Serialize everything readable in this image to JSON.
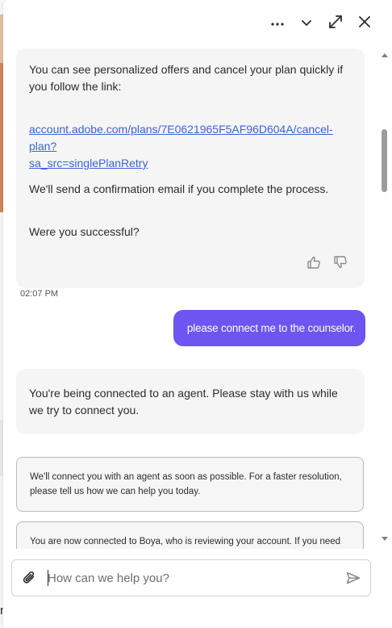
{
  "header": {
    "more_icon": "ellipsis-icon",
    "minimize_icon": "chevron-down-icon",
    "expand_icon": "expand-icon",
    "close_icon": "close-icon"
  },
  "messages": {
    "bot_1": {
      "line_1": "You can see personalized offers and cancel your plan quickly if you follow the link:",
      "link_line_1": "account.adobe.com/plans/7E0621965F5AF96D604A/cancel-plan?",
      "link_line_2": "sa_src=singlePlanRetry",
      "line_2": "We'll send a confirmation email if you complete the process.",
      "line_3": "Were you successful?"
    },
    "timestamp": "02:07 PM",
    "user_1": "please connect me to the counselor.",
    "bot_2": "You're being connected to an agent. Please stay with us while we try to connect you.",
    "card_1": "We'll connect you with an agent as soon as possible. For a faster resolution, please tell us how we can help you today.",
    "card_2": "You are now connected to Boya, who is reviewing your account. If you need"
  },
  "composer": {
    "placeholder": "How can we help you?",
    "attach_icon": "paperclip-icon",
    "send_icon": "send-icon"
  },
  "colors": {
    "accent": "#6e54f0",
    "link": "#3b63d8",
    "bubble_bg": "#f5f5f5"
  }
}
